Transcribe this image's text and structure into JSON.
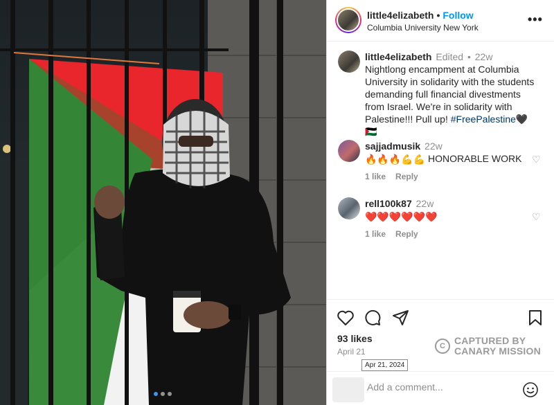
{
  "post": {
    "username": "little4elizabeth",
    "follow_label": "Follow",
    "location": "Columbia University New York",
    "more_icon": "more-horizontal-icon"
  },
  "caption": {
    "username": "little4elizabeth",
    "edited": "Edited",
    "time": "22w",
    "text": "Nightlong encampment at Columbia University in solidarity with the students demanding full financial divestments from Israel. We're in solidarity with Palestine!!! Pull up! ",
    "hashtag": "#FreePalestine",
    "suffix": "🖤🇵🇸"
  },
  "comments": [
    {
      "username": "sajjadmusik",
      "time": "22w",
      "emojis": "🔥🔥🔥💪💪",
      "text": " HONORABLE WORK",
      "likes_label": "1 like",
      "reply_label": "Reply"
    },
    {
      "username": "rell100k87",
      "time": "22w",
      "emojis": "❤️❤️❤️❤️❤️❤️",
      "text": "",
      "likes_label": "1 like",
      "reply_label": "Reply"
    }
  ],
  "engagement": {
    "likes": "93 likes",
    "date": "April 21",
    "date_tooltip": "Apr 21, 2024"
  },
  "watermark": {
    "line1": "CAPTURED BY",
    "line2": "CANARY MISSION"
  },
  "add_comment": {
    "placeholder": "Add a comment..."
  },
  "carousel": {
    "count": 3,
    "active_index": 0
  },
  "colors": {
    "accent_link": "#0095f6",
    "hashtag": "#00376b",
    "muted": "#8e8e8e",
    "flag_red": "#e8262b",
    "flag_green": "#3a8a3b",
    "flag_white": "#f2f2f2"
  }
}
